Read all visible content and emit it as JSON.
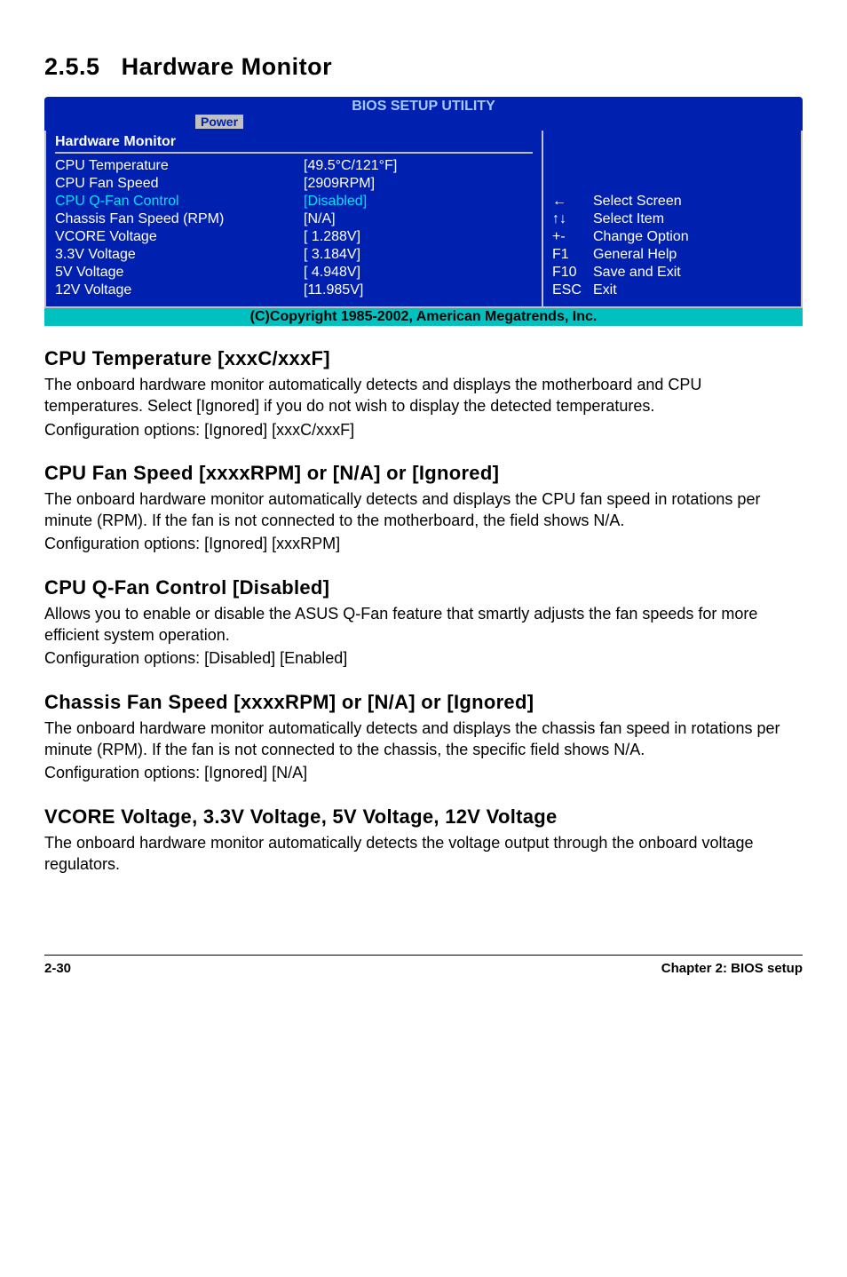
{
  "section": {
    "number": "2.5.5",
    "title": "Hardware Monitor"
  },
  "bios": {
    "utility_title": "BIOS SETUP UTILITY",
    "tab": "Power",
    "panel_title": "Hardware Monitor",
    "rows": [
      {
        "label": "CPU Temperature",
        "value": "[49.5°C/121°F]",
        "white": true
      },
      {
        "label": "",
        "value": ""
      },
      {
        "label": "CPU Fan Speed",
        "value": "[2909RPM]",
        "white": true
      },
      {
        "label": "CPU Q-Fan Control",
        "value": "[Disabled]"
      },
      {
        "label": "Chassis Fan Speed (RPM)",
        "value": "[N/A]",
        "white": true
      },
      {
        "label": "",
        "value": ""
      },
      {
        "label": "VCORE Voltage",
        "value": "[ 1.288V]",
        "white": true
      },
      {
        "label": "3.3V Voltage",
        "value": "[ 3.184V]",
        "white": true
      },
      {
        "label": "5V Voltage",
        "value": "[ 4.948V]",
        "white": true
      },
      {
        "label": "12V Voltage",
        "value": "[11.985V]",
        "white": true
      }
    ],
    "help": [
      {
        "key_icon": "arrows-lr",
        "text": "Select Screen"
      },
      {
        "key_icon": "arrows-ud",
        "text": "Select Item"
      },
      {
        "key": "+-",
        "text": "Change Option"
      },
      {
        "key": "F1",
        "text": "General Help"
      },
      {
        "key": "F10",
        "text": "Save and Exit"
      },
      {
        "key": "ESC",
        "text": "Exit"
      }
    ],
    "copyright": "(C)Copyright 1985-2002, American Megatrends, Inc."
  },
  "subsections": [
    {
      "title": "CPU Temperature [xxxC/xxxF]",
      "paras": [
        "The onboard hardware monitor automatically detects and displays the motherboard and CPU temperatures. Select [Ignored] if you do not wish to display the detected temperatures.",
        "Configuration options: [Ignored] [xxxC/xxxF]"
      ]
    },
    {
      "title": "CPU Fan Speed [xxxxRPM] or [N/A] or [Ignored]",
      "paras": [
        "The onboard hardware monitor automatically detects and displays the CPU fan speed in rotations per minute (RPM). If the fan is not connected to the motherboard, the field shows N/A.",
        "Configuration options: [Ignored] [xxxRPM]"
      ]
    },
    {
      "title": "CPU Q-Fan Control [Disabled]",
      "paras": [
        "Allows you to enable or disable the ASUS Q-Fan feature that smartly adjusts the fan speeds for more efficient system operation.",
        "Configuration options: [Disabled] [Enabled]"
      ]
    },
    {
      "title": "Chassis Fan Speed [xxxxRPM] or [N/A] or [Ignored]",
      "paras": [
        "The onboard hardware monitor automatically detects and displays the chassis fan speed in rotations per minute (RPM). If the fan is not connected to the chassis, the specific field shows N/A.",
        "Configuration options: [Ignored] [N/A]"
      ]
    },
    {
      "title": "VCORE Voltage, 3.3V Voltage, 5V Voltage, 12V Voltage",
      "paras": [
        "The onboard hardware monitor automatically detects the voltage output through the onboard voltage regulators."
      ]
    }
  ],
  "footer": {
    "left": "2-30",
    "right": "Chapter 2: BIOS setup"
  }
}
